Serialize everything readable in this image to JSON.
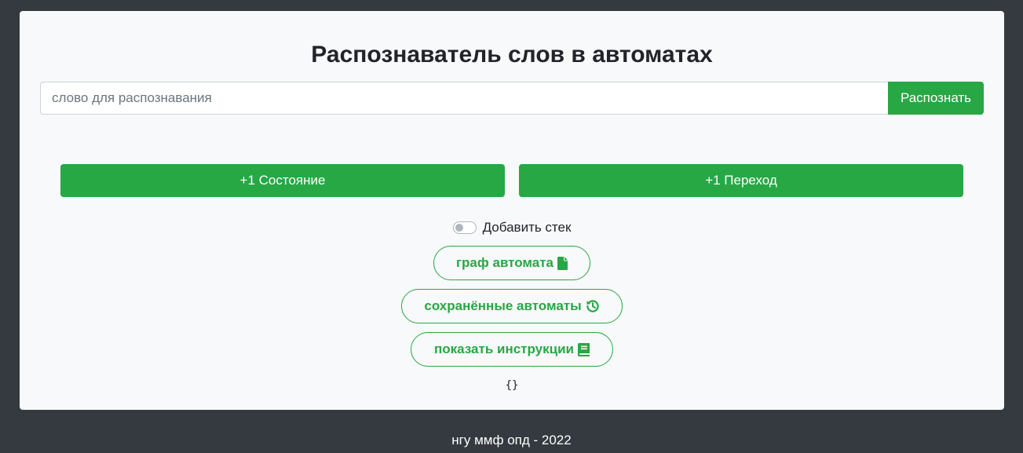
{
  "header": {
    "title": "Распознаватель слов в автоматах"
  },
  "recognize": {
    "placeholder": "слово для распознавания",
    "value": "",
    "button_label": "Распознать"
  },
  "actions": {
    "add_state_label": "+1 Состояние",
    "add_transition_label": "+1 Переход"
  },
  "stack_toggle": {
    "label": "Добавить стек",
    "checked": false
  },
  "pills": {
    "graph_label": "граф автомата",
    "graph_icon": "file-icon",
    "saved_label": "сохранённые автоматы",
    "saved_icon": "history-icon",
    "instructions_label": "показать инструкции",
    "instructions_icon": "book-icon"
  },
  "output": {
    "json": "{}"
  },
  "footer": {
    "text": "нгу ммф опд - 2022"
  },
  "colors": {
    "page_background": "#343a40",
    "card_background": "#f8f9fa",
    "accent_green": "#28a745",
    "text_dark": "#212529"
  }
}
